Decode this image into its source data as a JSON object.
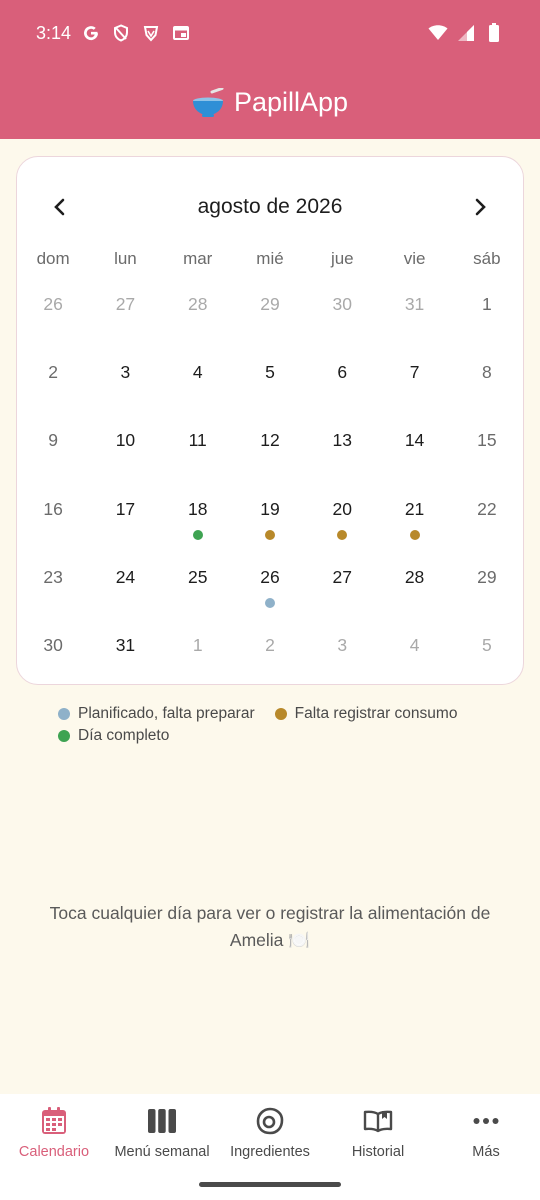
{
  "status_bar": {
    "time": "3:14",
    "left_icons": [
      "google-icon",
      "shield-icon",
      "vpn-icon",
      "browser-icon"
    ],
    "right_icons": [
      "wifi-icon",
      "signal-icon",
      "battery-icon"
    ]
  },
  "app_bar": {
    "title": "PapillApp",
    "logo_icon": "bowl-icon"
  },
  "calendar": {
    "month_title": "agosto de 2026",
    "weekdays": [
      "dom",
      "lun",
      "mar",
      "mié",
      "jue",
      "vie",
      "sáb"
    ],
    "days": [
      {
        "label": "26",
        "in_month": false
      },
      {
        "label": "27",
        "in_month": false
      },
      {
        "label": "28",
        "in_month": false
      },
      {
        "label": "29",
        "in_month": false
      },
      {
        "label": "30",
        "in_month": false
      },
      {
        "label": "31",
        "in_month": false
      },
      {
        "label": "1",
        "in_month": true
      },
      {
        "label": "2",
        "in_month": true
      },
      {
        "label": "3",
        "in_month": true
      },
      {
        "label": "4",
        "in_month": true
      },
      {
        "label": "5",
        "in_month": true
      },
      {
        "label": "6",
        "in_month": true
      },
      {
        "label": "7",
        "in_month": true
      },
      {
        "label": "8",
        "in_month": true
      },
      {
        "label": "9",
        "in_month": true
      },
      {
        "label": "10",
        "in_month": true
      },
      {
        "label": "11",
        "in_month": true
      },
      {
        "label": "12",
        "in_month": true
      },
      {
        "label": "13",
        "in_month": true
      },
      {
        "label": "14",
        "in_month": true
      },
      {
        "label": "15",
        "in_month": true
      },
      {
        "label": "16",
        "in_month": true
      },
      {
        "label": "17",
        "in_month": true
      },
      {
        "label": "18",
        "in_month": true,
        "status": "complete"
      },
      {
        "label": "19",
        "in_month": true,
        "status": "pending_consumption"
      },
      {
        "label": "20",
        "in_month": true,
        "status": "pending_consumption"
      },
      {
        "label": "21",
        "in_month": true,
        "status": "pending_consumption"
      },
      {
        "label": "22",
        "in_month": true
      },
      {
        "label": "23",
        "in_month": true
      },
      {
        "label": "24",
        "in_month": true
      },
      {
        "label": "25",
        "in_month": true
      },
      {
        "label": "26",
        "in_month": true,
        "status": "planned"
      },
      {
        "label": "27",
        "in_month": true
      },
      {
        "label": "28",
        "in_month": true
      },
      {
        "label": "29",
        "in_month": true
      },
      {
        "label": "30",
        "in_month": true
      },
      {
        "label": "31",
        "in_month": true
      },
      {
        "label": "1",
        "in_month": false
      },
      {
        "label": "2",
        "in_month": false
      },
      {
        "label": "3",
        "in_month": false
      },
      {
        "label": "4",
        "in_month": false
      },
      {
        "label": "5",
        "in_month": false
      }
    ]
  },
  "legend": [
    {
      "key": "planned",
      "label": "Planificado, falta preparar",
      "color": "#8fb1c9"
    },
    {
      "key": "pending_consumption",
      "label": "Falta registrar consumo",
      "color": "#b8892a"
    },
    {
      "key": "complete",
      "label": "Día completo",
      "color": "#3ea352"
    }
  ],
  "hint_text": "Toca cualquier día para ver o registrar la alimentación de Amelia 🍽️",
  "bottom_nav": [
    {
      "label": "Calendario",
      "icon": "calendar-icon",
      "active": true
    },
    {
      "label": "Menú semanal",
      "icon": "columns-icon",
      "active": false
    },
    {
      "label": "Ingredientes",
      "icon": "egg-icon",
      "active": false
    },
    {
      "label": "Historial",
      "icon": "book-icon",
      "active": false
    },
    {
      "label": "Más",
      "icon": "more-icon",
      "active": false
    }
  ],
  "colors": {
    "primary": "#d95f7a",
    "background": "#fdf9ec"
  }
}
